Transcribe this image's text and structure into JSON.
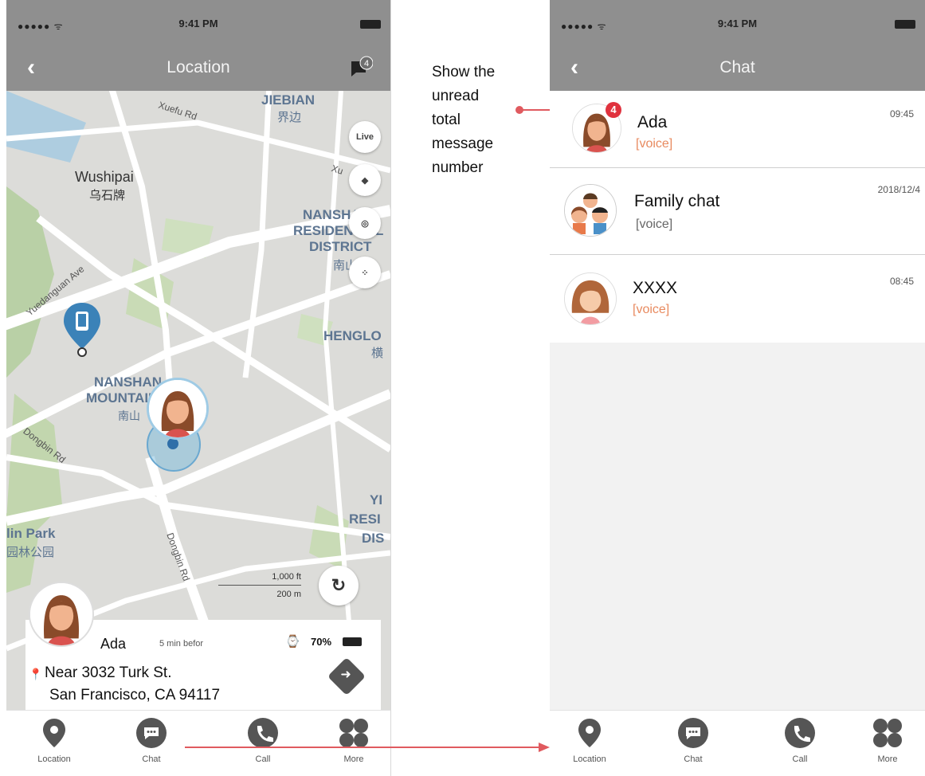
{
  "status_bar": {
    "signal": "●●●●● ᯤ",
    "time": "9:41 PM"
  },
  "location_screen": {
    "title": "Location",
    "unread_badge": "4",
    "map_labels": {
      "xuefu": "Xuefu Rd",
      "jiebian": "JIEBIAN",
      "jiebian_cn": "界边",
      "wushipai": "Wushipai",
      "wushipai_cn": "乌石牌",
      "xu": "Xu",
      "nanshan_res_1": "NANSHAN",
      "nanshan_res_2": "RESIDENTIAL",
      "nanshan_res_3": "DISTRICT",
      "nanshan_res_cn": "南山",
      "yuedanguan": "Yuedanguan Ave",
      "henglo": "HENGLO",
      "henglo_cn": "横",
      "nanshan_mtn_1": "NANSHAN",
      "nanshan_mtn_2": "MOUNTAIN",
      "nanshan_mtn_cn": "南山",
      "dongbin": "Dongbin Rd",
      "dongbin2": "Dongbin Rd",
      "yi_1": "YI",
      "yi_2": "RESI",
      "yi_3": "DIS",
      "linpark": "lin Park",
      "linpark_cn": "园林公园"
    },
    "live_label": "Live",
    "scale": {
      "ft": "1,000 ft",
      "m": "200 m"
    },
    "person": {
      "name": "Ada",
      "time_ago": "5 min befor",
      "battery": "70%",
      "address_line1": "Near 3032 Turk St.",
      "address_line2": "San Francisco, CA 94117"
    }
  },
  "annotation": [
    "Show the",
    "unread",
    "total",
    "message",
    "number"
  ],
  "chat_screen": {
    "title": "Chat",
    "items": [
      {
        "name": "Ada",
        "preview": "[voice]",
        "time": "09:45",
        "badge": "4",
        "preview_color": "#e88a5f"
      },
      {
        "name": "Family chat",
        "preview": "[voice]",
        "time": "2018/12/4",
        "badge": "",
        "preview_color": "#666666"
      },
      {
        "name": "XXXX",
        "preview": "[voice]",
        "time": "08:45",
        "badge": "",
        "preview_color": "#e88a5f"
      }
    ]
  },
  "tabbar": [
    "Location",
    "Chat",
    "Call",
    "More"
  ],
  "colors": {
    "header": "#8f8f8f",
    "badge": "#e0323e",
    "map_label": "#5d7591",
    "accent": "#e05a5f"
  }
}
